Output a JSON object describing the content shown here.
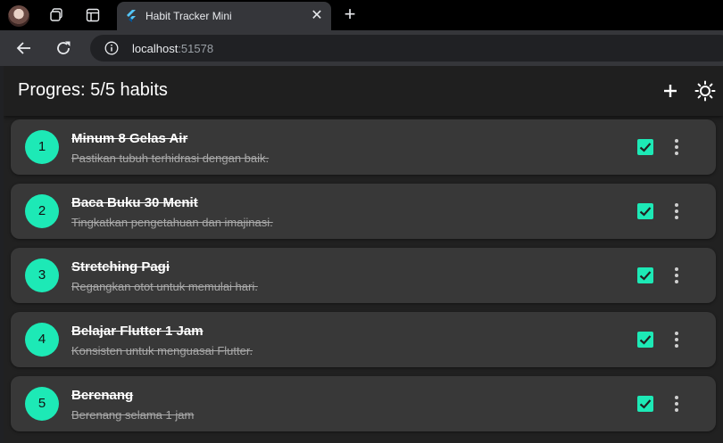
{
  "browser": {
    "tab_title": "Habit Tracker Mini",
    "url_host": "localhost",
    "url_port": ":51578"
  },
  "app": {
    "title": "Progres: 5/5 habits",
    "accent_color": "#1de9b6",
    "habits": [
      {
        "number": "1",
        "title": "Minum 8 Gelas Air",
        "description": "Pastikan tubuh terhidrasi dengan baik.",
        "completed": true
      },
      {
        "number": "2",
        "title": "Baca Buku 30 Menit",
        "description": "Tingkatkan pengetahuan dan imajinasi.",
        "completed": true
      },
      {
        "number": "3",
        "title": "Stretching Pagi",
        "description": "Regangkan otot untuk memulai hari.",
        "completed": true
      },
      {
        "number": "4",
        "title": "Belajar Flutter 1 Jam",
        "description": "Konsisten untuk menguasai Flutter.",
        "completed": true
      },
      {
        "number": "5",
        "title": "Berenang",
        "description": "Berenang selama 1 jam",
        "completed": true
      }
    ]
  },
  "icons": {
    "add": "add-icon",
    "theme": "sun-icon",
    "check": "check-icon",
    "more": "more-vert-icon"
  }
}
